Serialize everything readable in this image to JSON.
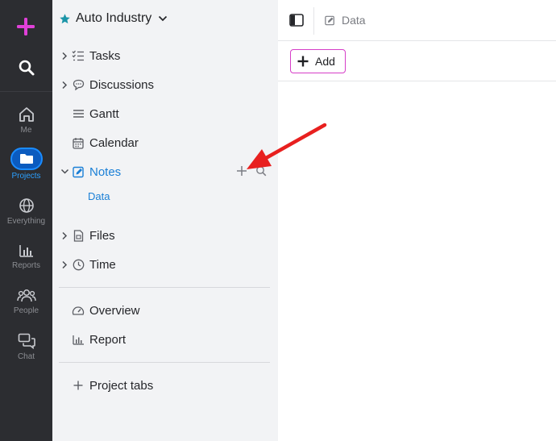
{
  "rail": {
    "items": [
      {
        "label": "Me"
      },
      {
        "label": "Projects"
      },
      {
        "label": "Everything"
      },
      {
        "label": "Reports"
      },
      {
        "label": "People"
      },
      {
        "label": "Chat"
      }
    ]
  },
  "sidebar": {
    "project_name": "Auto Industry",
    "nav": [
      {
        "label": "Tasks"
      },
      {
        "label": "Discussions"
      },
      {
        "label": "Gantt"
      },
      {
        "label": "Calendar"
      },
      {
        "label": "Notes"
      },
      {
        "label": "Files"
      },
      {
        "label": "Time"
      }
    ],
    "notes_subitem": "Data",
    "extra": [
      {
        "label": "Overview"
      },
      {
        "label": "Report"
      }
    ],
    "project_tabs": "Project tabs"
  },
  "topbar": {
    "breadcrumb": "Data"
  },
  "actions": {
    "add_label": "Add"
  },
  "colors": {
    "rail_bg": "#2c2d31",
    "accent_blue": "#1a7fd6",
    "plus_magenta": "#e040d8",
    "annotation_red": "#e8201f"
  }
}
